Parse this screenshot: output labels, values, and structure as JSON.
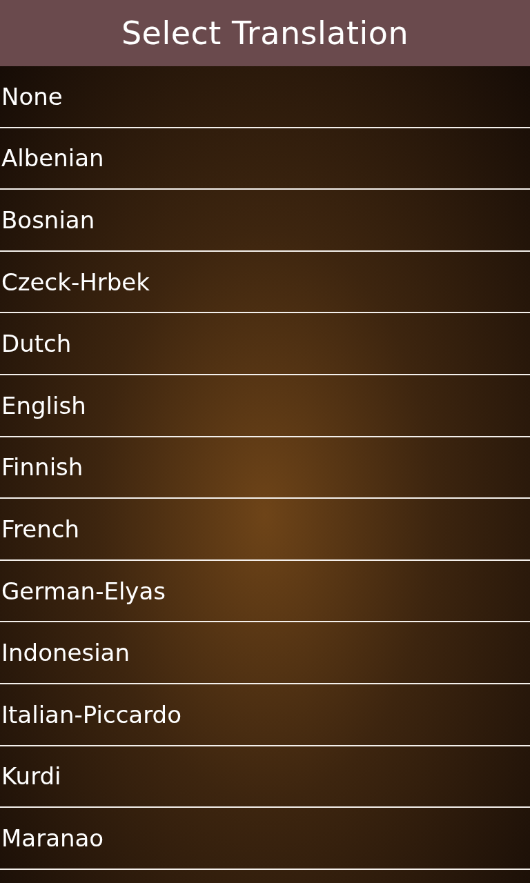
{
  "header": {
    "title": "Select Translation"
  },
  "translations": [
    {
      "label": "None"
    },
    {
      "label": "Albenian"
    },
    {
      "label": "Bosnian"
    },
    {
      "label": "Czeck-Hrbek"
    },
    {
      "label": "Dutch"
    },
    {
      "label": "English"
    },
    {
      "label": "Finnish"
    },
    {
      "label": "French"
    },
    {
      "label": "German-Elyas"
    },
    {
      "label": "Indonesian"
    },
    {
      "label": "Italian-Piccardo"
    },
    {
      "label": "Kurdi"
    },
    {
      "label": "Maranao"
    }
  ]
}
